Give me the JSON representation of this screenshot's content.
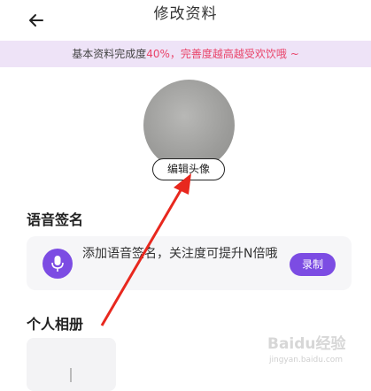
{
  "header": {
    "title": "修改资料",
    "back_icon": "arrow-left-icon"
  },
  "banner": {
    "prefix": "基本资料完成度",
    "percent": "40%",
    "suffix": "，完善度越高越受欢饮哦 ~"
  },
  "avatar": {
    "edit_label": "编辑头像"
  },
  "voice_signature": {
    "title": "语音签名",
    "description": "添加语音签名，关注度可提升N倍哦",
    "record_label": "录制",
    "mic_icon": "microphone-icon"
  },
  "album": {
    "title": "个人相册",
    "add_icon": "plus-icon"
  },
  "watermark": {
    "text": "Baidu经验",
    "url": "jingyan.baidu.com"
  },
  "colors": {
    "accent": "#7c4ce3",
    "highlight": "#e9446a",
    "banner_bg": "#eee3f7",
    "annotation": "#e8281e"
  }
}
